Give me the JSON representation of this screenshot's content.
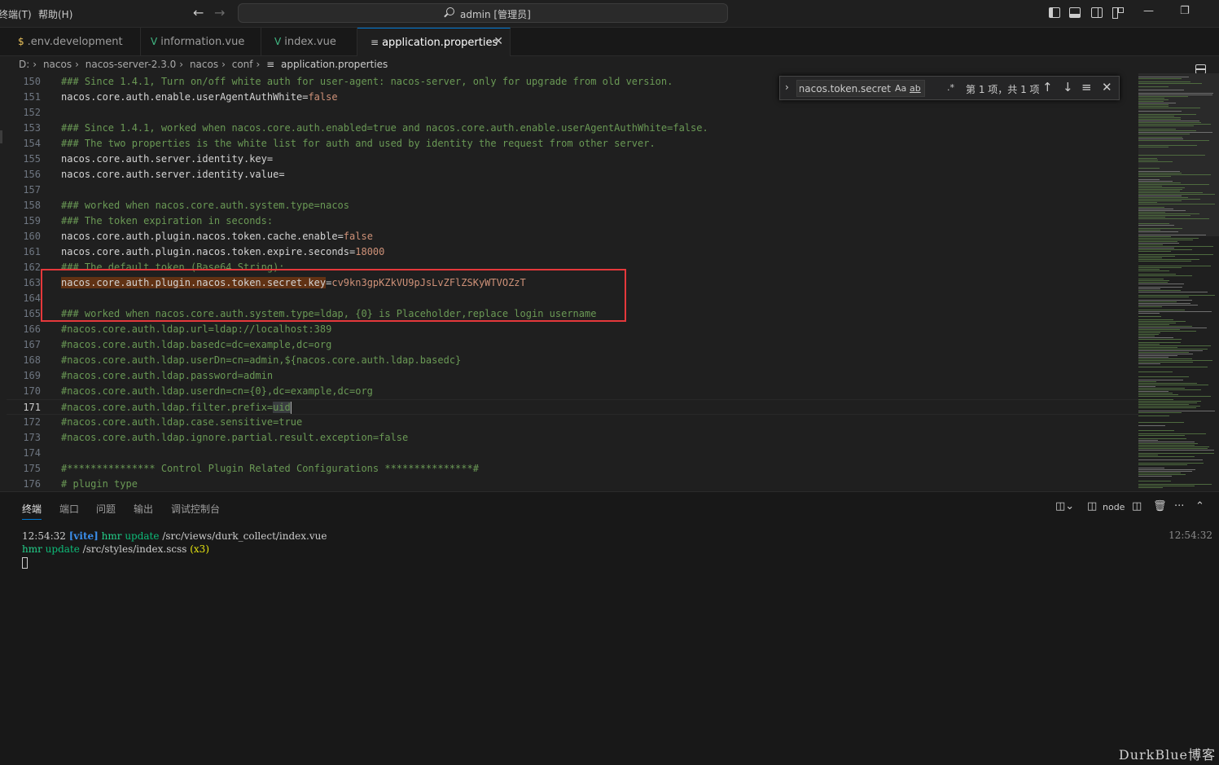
{
  "menu": {
    "terminal": "终端(T)",
    "help": "帮助(H)"
  },
  "command_center": {
    "label": "admin [管理员]"
  },
  "tabs": [
    {
      "icon": "$",
      "label": ".env.development"
    },
    {
      "icon": "V",
      "label": "information.vue"
    },
    {
      "icon": "V",
      "label": "index.vue"
    },
    {
      "icon": "≡",
      "label": "application.properties"
    }
  ],
  "breadcrumb": [
    "D:",
    "nacos",
    "nacos-server-2.3.0",
    "nacos",
    "conf",
    "application.properties"
  ],
  "editor": {
    "lines": [
      {
        "n": "150",
        "text": "### Since 1.4.1, Turn on/off white auth for user-agent: nacos-server, only for upgrade from old version."
      },
      {
        "n": "151",
        "key": "nacos.core.auth.enable.userAgentAuthWhite",
        "val": "false"
      },
      {
        "n": "152",
        "text": ""
      },
      {
        "n": "153",
        "text": "### Since 1.4.1, worked when nacos.core.auth.enabled=true and nacos.core.auth.enable.userAgentAuthWhite=false."
      },
      {
        "n": "154",
        "text": "### The two properties is the white list for auth and used by identity the request from other server."
      },
      {
        "n": "155",
        "key": "nacos.core.auth.server.identity.key",
        "val": ""
      },
      {
        "n": "156",
        "key": "nacos.core.auth.server.identity.value",
        "val": ""
      },
      {
        "n": "157",
        "text": ""
      },
      {
        "n": "158",
        "text": "### worked when nacos.core.auth.system.type=nacos"
      },
      {
        "n": "159",
        "text": "### The token expiration in seconds:"
      },
      {
        "n": "160",
        "key": "nacos.core.auth.plugin.nacos.token.cache.enable",
        "val": "false"
      },
      {
        "n": "161",
        "key": "nacos.core.auth.plugin.nacos.token.expire.seconds",
        "val": "18000"
      },
      {
        "n": "162",
        "text": "### The default token (Base64 String):"
      },
      {
        "n": "163",
        "key": "nacos.core.auth.plugin.nacos.token.secret.key",
        "val": "cv9kn3gpKZkVU9pJsLvZFlZSKyWTVOZzT"
      },
      {
        "n": "164",
        "text": ""
      },
      {
        "n": "165",
        "text": "### worked when nacos.core.auth.system.type=ldap, {0} is Placeholder,replace login username"
      },
      {
        "n": "166",
        "text": "#nacos.core.auth.ldap.url=ldap://localhost:389"
      },
      {
        "n": "167",
        "text": "#nacos.core.auth.ldap.basedc=dc=example,dc=org"
      },
      {
        "n": "168",
        "text": "#nacos.core.auth.ldap.userDn=cn=admin,${nacos.core.auth.ldap.basedc}"
      },
      {
        "n": "169",
        "text": "#nacos.core.auth.ldap.password=admin"
      },
      {
        "n": "170",
        "text": "#nacos.core.auth.ldap.userdn=cn={0},dc=example,dc=org"
      },
      {
        "n": "171",
        "text_before": "#nacos.core.auth.ldap.filter.prefix=",
        "text_sel": "uid"
      },
      {
        "n": "172",
        "text": "#nacos.core.auth.ldap.case.sensitive=true"
      },
      {
        "n": "173",
        "text": "#nacos.core.auth.ldap.ignore.partial.result.exception=false"
      },
      {
        "n": "174",
        "text": ""
      },
      {
        "n": "175",
        "text": "#*************** Control Plugin Related Configurations ***************#"
      },
      {
        "n": "176",
        "text": "# plugin type"
      }
    ]
  },
  "find": {
    "query": "nacos.core.auth.plugin.nacos.token.secret.",
    "opt_case": "Aa",
    "opt_word": "ab",
    "opt_regex": ".*",
    "count": "第 1 项，共 1 项"
  },
  "panel": {
    "tabs": [
      "终端",
      "端口",
      "问题",
      "输出",
      "调试控制台"
    ],
    "node_label": "node",
    "terminal": {
      "time": "12:54:32",
      "vite": "[vite]",
      "hmr": "hmr",
      "update": "update",
      "path1": "/src/views/durk_collect/index.vue",
      "path2": "/src/styles/index.scss",
      "count": "(x3)",
      "right_time": "12:54:32"
    }
  },
  "watermark": "DurkBlue博客"
}
